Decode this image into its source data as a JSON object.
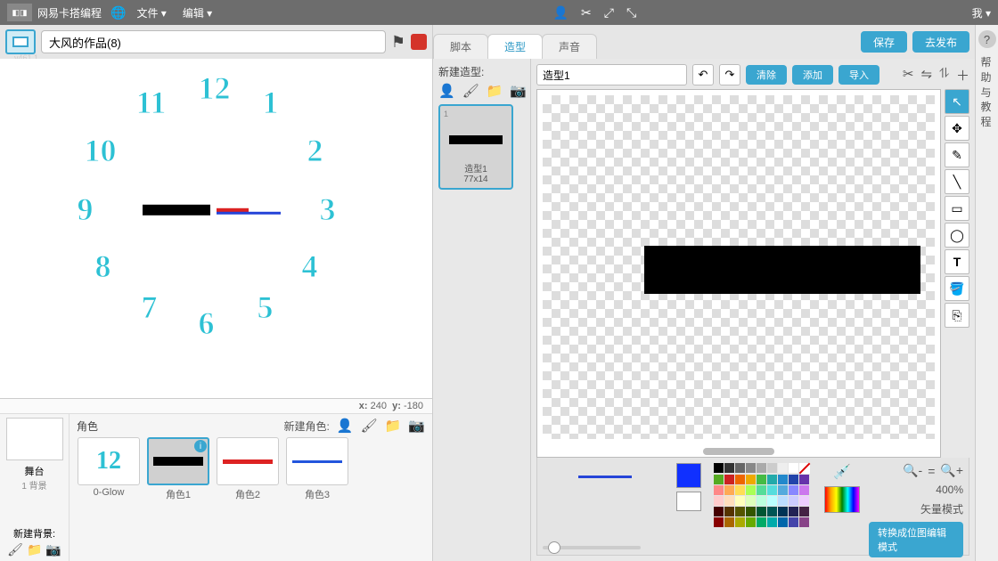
{
  "topbar": {
    "brand": "网易卡搭编程",
    "file": "文件 ▾",
    "edit": "编辑 ▾",
    "me": "我 ▾"
  },
  "version": "v461.1",
  "project_name": "大风的作品(8)",
  "coords": {
    "x_label": "x:",
    "x": "240",
    "y_label": "y:",
    "y": "-180"
  },
  "clock_numbers": [
    "12",
    "1",
    "2",
    "3",
    "4",
    "5",
    "6",
    "7",
    "8",
    "9",
    "10",
    "11"
  ],
  "backdrop": {
    "title": "舞台",
    "sub": "1 背景",
    "new": "新建背景:"
  },
  "sprites": {
    "title": "角色",
    "new": "新建角色:",
    "items": [
      {
        "name": "0-Glow"
      },
      {
        "name": "角色1"
      },
      {
        "name": "角色2"
      },
      {
        "name": "角色3"
      }
    ]
  },
  "tabs": {
    "scripts": "脚本",
    "costumes": "造型",
    "sounds": "声音"
  },
  "actions": {
    "save": "保存",
    "publish": "去发布"
  },
  "costumes": {
    "new": "新建造型:",
    "item": {
      "num": "1",
      "name": "造型1",
      "dims": "77x14"
    }
  },
  "paint": {
    "name": "造型1",
    "clear": "清除",
    "add": "添加",
    "import": "导入",
    "zoom": "400%",
    "mode": "矢量模式",
    "mode_switch": "转换成位图编辑模式"
  },
  "help": {
    "text": "帮助与教程"
  },
  "palette": [
    [
      "#000",
      "#333",
      "#666",
      "#888",
      "#aaa",
      "#ccc",
      "#eee",
      "#fff",
      "NO"
    ],
    [
      "#5a2",
      "#c22",
      "#e60",
      "#ea0",
      "#4b4",
      "#2aa",
      "#28c",
      "#24a",
      "#63a"
    ],
    [
      "#f88",
      "#fa5",
      "#fd5",
      "#af5",
      "#5d9",
      "#5dd",
      "#5ad",
      "#88f",
      "#c7e"
    ],
    [
      "#fcc",
      "#fdb",
      "#ffb",
      "#dfb",
      "#bfd",
      "#bff",
      "#bdf",
      "#ccf",
      "#ecf"
    ],
    [
      "#400",
      "#530",
      "#550",
      "#350",
      "#053",
      "#055",
      "#035",
      "#225",
      "#424"
    ],
    [
      "#800",
      "#a60",
      "#aa0",
      "#6a0",
      "#0a6",
      "#0aa",
      "#06a",
      "#44a",
      "#848"
    ]
  ]
}
